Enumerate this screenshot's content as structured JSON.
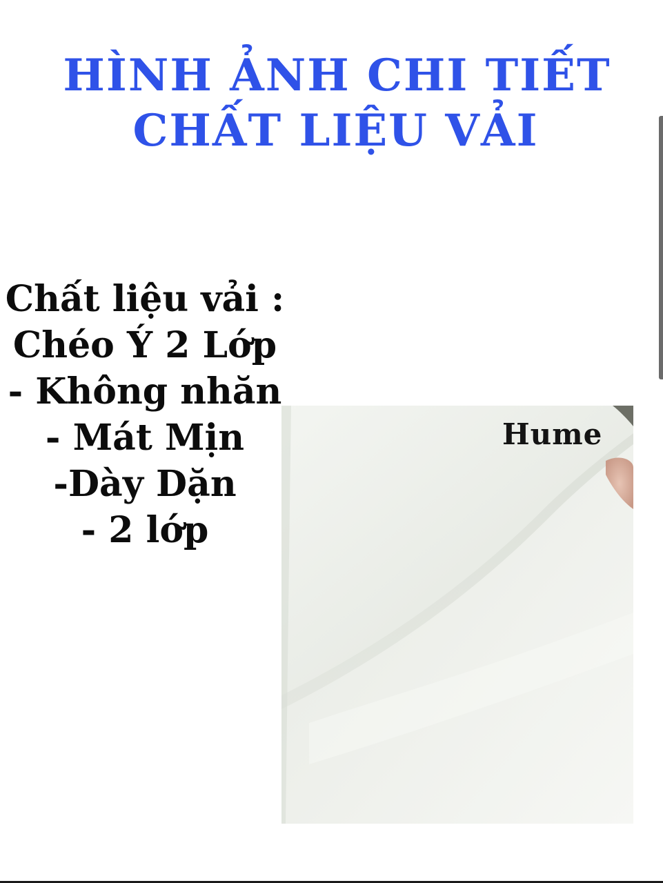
{
  "title": {
    "line1": "HÌNH ẢNH CHI TIẾT",
    "line2": "CHẤT LIỆU VẢI",
    "color": "#2f52e8"
  },
  "spec": {
    "lines": [
      "Chất liệu vải :",
      "Chéo Ý 2 Lớp",
      "- Không nhăn",
      "- Mát Mịn",
      "-Dày Dặn",
      "- 2 lớp"
    ]
  },
  "photo": {
    "watermark": "Hume",
    "subject": "white fabric close-up"
  }
}
